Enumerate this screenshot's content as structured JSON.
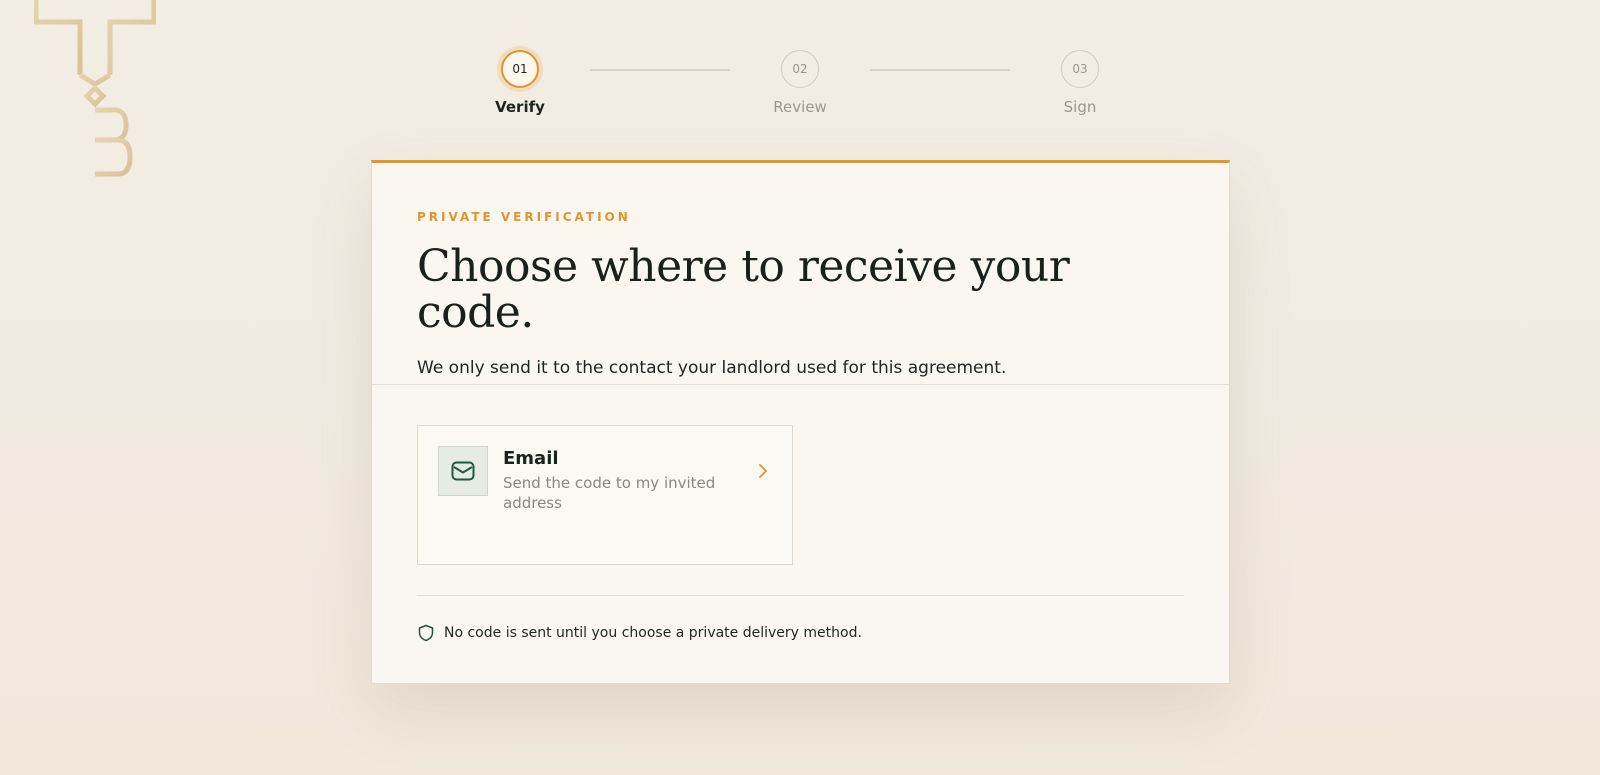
{
  "stepper": {
    "steps": [
      {
        "number": "01",
        "label": "Verify",
        "state": "active"
      },
      {
        "number": "02",
        "label": "Review",
        "state": "upcoming"
      },
      {
        "number": "03",
        "label": "Sign",
        "state": "upcoming"
      }
    ]
  },
  "card": {
    "eyebrow": "PRIVATE VERIFICATION",
    "headline": "Choose where to receive your code.",
    "subhead": "We only send it to the contact your landlord used for this agreement.",
    "options": [
      {
        "title": "Email",
        "description": "Send the code to my invited address",
        "icon": "envelope-icon"
      }
    ],
    "note": "No code is sent until you choose a private delivery method.",
    "note_icon": "shield-icon"
  },
  "colors": {
    "accent": "#e2962b",
    "icon_green": "#1f5a3c",
    "text_dark": "#18221d",
    "text_muted": "#8c8880"
  }
}
